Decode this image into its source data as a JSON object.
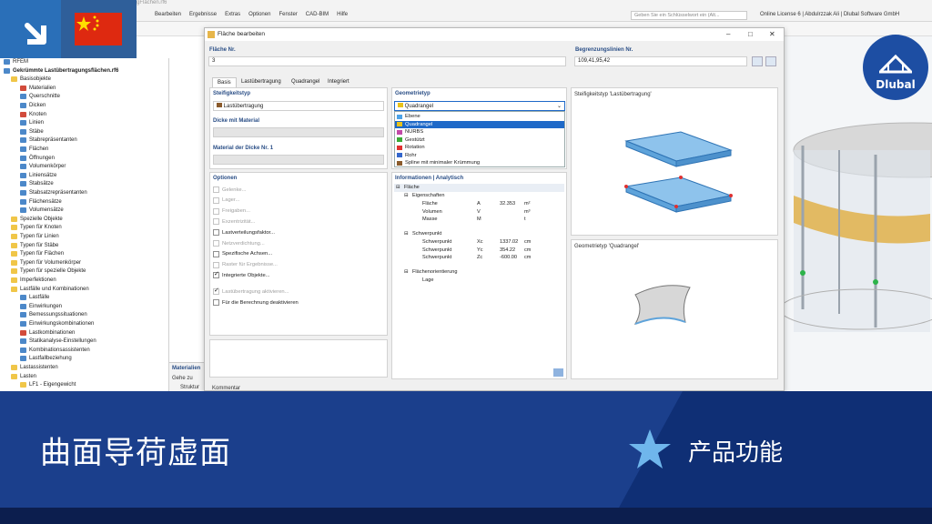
{
  "app": {
    "title_fragment": "gFlächen.rf6",
    "menu": [
      "Bearbeiten",
      "Ergebnisse",
      "Extras",
      "Optionen",
      "Fenster",
      "CAD-BIM",
      "Hilfe"
    ],
    "search_placeholder": "Geben Sie ein Schlüsselwort ein (Alt...",
    "license": "Online License 6 | Abdulrzzak Ali | Dlubal Software GmbH"
  },
  "navigator": {
    "items": [
      {
        "label": "RFEM",
        "icon": "rfem-icon",
        "color": "blue"
      },
      {
        "label": "Gekrümmte Lastübertragungsflächen.rf6",
        "icon": "model-icon",
        "color": "blue"
      },
      {
        "label": "Basisobjekte",
        "icon": "folder-icon",
        "color": "folder"
      },
      {
        "label": "Materialien",
        "icon": "material-icon",
        "color": "red"
      },
      {
        "label": "Querschnitte",
        "icon": "section-icon",
        "color": "blue"
      },
      {
        "label": "Dicken",
        "icon": "thickness-icon",
        "color": "blue"
      },
      {
        "label": "Knoten",
        "icon": "node-icon",
        "color": "red"
      },
      {
        "label": "Linien",
        "icon": "line-icon",
        "color": "blue"
      },
      {
        "label": "Stäbe",
        "icon": "member-icon",
        "color": "blue"
      },
      {
        "label": "Stabrepräsentanten",
        "icon": "member-rep-icon",
        "color": "blue"
      },
      {
        "label": "Flächen",
        "icon": "surface-icon",
        "color": "blue"
      },
      {
        "label": "Öffnungen",
        "icon": "opening-icon",
        "color": "blue"
      },
      {
        "label": "Volumenkörper",
        "icon": "solid-icon",
        "color": "blue"
      },
      {
        "label": "Liniensätze",
        "icon": "lineset-icon",
        "color": "blue"
      },
      {
        "label": "Stabsätze",
        "icon": "memberset-icon",
        "color": "blue"
      },
      {
        "label": "Stabsatzrepräsentanten",
        "icon": "memberset-rep-icon",
        "color": "blue"
      },
      {
        "label": "Flächensätze",
        "icon": "surfaceset-icon",
        "color": "blue"
      },
      {
        "label": "Volumensätze",
        "icon": "solidset-icon",
        "color": "blue"
      },
      {
        "label": "Spezielle Objekte",
        "icon": "folder-icon",
        "color": "folder"
      },
      {
        "label": "Typen für Knoten",
        "icon": "folder-icon",
        "color": "folder"
      },
      {
        "label": "Typen für Linien",
        "icon": "folder-icon",
        "color": "folder"
      },
      {
        "label": "Typen für Stäbe",
        "icon": "folder-icon",
        "color": "folder"
      },
      {
        "label": "Typen für Flächen",
        "icon": "folder-icon",
        "color": "folder"
      },
      {
        "label": "Typen für Volumenkörper",
        "icon": "folder-icon",
        "color": "folder"
      },
      {
        "label": "Typen für spezielle Objekte",
        "icon": "folder-icon",
        "color": "folder"
      },
      {
        "label": "Imperfektionen",
        "icon": "folder-icon",
        "color": "folder"
      },
      {
        "label": "Lastfälle und Kombinationen",
        "icon": "folder-icon",
        "color": "folder"
      },
      {
        "label": "Lastfälle",
        "icon": "loadcase-icon",
        "color": "blue"
      },
      {
        "label": "Einwirkungen",
        "icon": "action-icon",
        "color": "blue"
      },
      {
        "label": "Bemessungssituationen",
        "icon": "design-situation-icon",
        "color": "blue"
      },
      {
        "label": "Einwirkungskombinationen",
        "icon": "action-combo-icon",
        "color": "blue"
      },
      {
        "label": "Lastkombinationen",
        "icon": "load-combo-icon",
        "color": "red"
      },
      {
        "label": "Statikanalyse-Einstellungen",
        "icon": "analysis-settings-icon",
        "color": "blue"
      },
      {
        "label": "Kombinationsassistenten",
        "icon": "combo-wizard-icon",
        "color": "blue"
      },
      {
        "label": "Lastfallbeziehung",
        "icon": "loadcase-relation-icon",
        "color": "blue"
      },
      {
        "label": "Lastassistenten",
        "icon": "folder-icon",
        "color": "folder"
      },
      {
        "label": "Lasten",
        "icon": "folder-icon",
        "color": "folder"
      },
      {
        "label": "LF1 - Eigengewicht",
        "icon": "folder-icon",
        "color": "folder"
      }
    ]
  },
  "dialog": {
    "title": "Fläche bearbeiten",
    "surface_no_label": "Fläche Nr.",
    "surface_no": "3",
    "boundary_label": "Begrenzungslinien Nr.",
    "boundary_value": "109,41,95,42",
    "tabs": [
      "Basis",
      "Lastübertragung",
      "Quadrangel",
      "Integriert"
    ],
    "stiffness_label": "Steifigkeitstyp",
    "stiffness_value": "Lastübertragung",
    "thickness_material_label": "Dicke mit Material",
    "material_thickness_label": "Material der Dicke Nr. 1",
    "geometry_label": "Geometrietyp",
    "geometry_value": "Quadrangel",
    "geometry_options": [
      {
        "label": "Ebene",
        "color": "#4da3e8"
      },
      {
        "label": "Quadrangel",
        "color": "#e8c21a"
      },
      {
        "label": "NURBS",
        "color": "#c24aa8"
      },
      {
        "label": "Gestützt",
        "color": "#3aaa35"
      },
      {
        "label": "Rotation",
        "color": "#e03030"
      },
      {
        "label": "Rohr",
        "color": "#3366cc"
      },
      {
        "label": "Spline mit minimaler Krümmung",
        "color": "#8a5a2b"
      }
    ],
    "options_label": "Optionen",
    "options": [
      {
        "label": "Gelenke...",
        "checked": false,
        "disabled": true
      },
      {
        "label": "Lager...",
        "checked": false,
        "disabled": true
      },
      {
        "label": "Freigaben...",
        "checked": false,
        "disabled": true
      },
      {
        "label": "Exzentrizität...",
        "checked": false,
        "disabled": true
      },
      {
        "label": "Lastverteilungsfaktor...",
        "checked": false,
        "disabled": false
      },
      {
        "label": "Netzverdichtung...",
        "checked": false,
        "disabled": true
      },
      {
        "label": "Spezifische Achsen...",
        "checked": false,
        "disabled": false
      },
      {
        "label": "Raster für Ergebnisse...",
        "checked": false,
        "disabled": true
      },
      {
        "label": "Integrierte Objekte...",
        "checked": true,
        "disabled": false
      },
      {
        "label": "Lastübertragung aktivieren...",
        "checked": true,
        "disabled": true
      },
      {
        "label": "Für die Berechnung deaktivieren",
        "checked": false,
        "disabled": false
      }
    ],
    "info_label": "Informationen | Analytisch",
    "info": {
      "surface": "Fläche",
      "properties": "Eigenschaften",
      "rows1": [
        {
          "name": "Fläche",
          "sym": "A",
          "val": "32.353",
          "unit": "m²"
        },
        {
          "name": "Volumen",
          "sym": "V",
          "val": "",
          "unit": "m³"
        },
        {
          "name": "Masse",
          "sym": "M",
          "val": "",
          "unit": "t"
        }
      ],
      "centroid": "Schwerpunkt",
      "rows2": [
        {
          "name": "Schwerpunkt",
          "sym": "Xc",
          "val": "1337.02",
          "unit": "cm"
        },
        {
          "name": "Schwerpunkt",
          "sym": "Yc",
          "val": "354.22",
          "unit": "cm"
        },
        {
          "name": "Schwerpunkt",
          "sym": "Zc",
          "val": "-600.00",
          "unit": "cm"
        }
      ],
      "orientation": "Flächenorientierung",
      "position": "Lage"
    },
    "preview1_label": "Steifigkeitstyp 'Lastübertragung'",
    "preview2_label": "Geometrietyp 'Quadrangel'",
    "comment_label": "Kommentar"
  },
  "bottom_panel": {
    "title": "Materialien",
    "goto": "Gehe zu",
    "item": "Struktur"
  },
  "logo": "Dlubal",
  "banner": {
    "title": "曲面导荷虚面",
    "tag": "产品功能"
  },
  "colors": {
    "banner": "#1b3f8c",
    "banner_dark": "#0f2f75",
    "selection": "#1e69c8",
    "badge_blue": "#2a6fb8"
  }
}
